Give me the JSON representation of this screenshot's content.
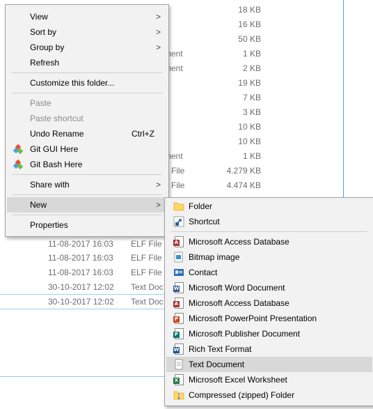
{
  "explorer": {
    "rows": [
      {
        "type": "",
        "size": "18 KB"
      },
      {
        "type": "",
        "size": "16 KB"
      },
      {
        "type": "",
        "size": "50 KB"
      },
      {
        "type": "ment",
        "size": "1 KB"
      },
      {
        "type": "ment",
        "size": "2 KB"
      },
      {
        "type": "e",
        "size": "19 KB"
      },
      {
        "type": "",
        "size": "7 KB"
      },
      {
        "type": "",
        "size": "3 KB"
      },
      {
        "type": "",
        "size": "10 KB"
      },
      {
        "type": "",
        "size": "10 KB"
      },
      {
        "type": "ment",
        "size": "1 KB"
      },
      {
        "type": "e File",
        "size": "4.279 KB"
      },
      {
        "type": "e File",
        "size": "4.474 KB"
      }
    ],
    "lower_rows": [
      {
        "date": "11-08-2017 16:03",
        "type": "ELF File"
      },
      {
        "date": "11-08-2017 16:03",
        "type": "ELF File"
      },
      {
        "date": "11-08-2017 16:03",
        "type": "ELF File"
      },
      {
        "date": "30-10-2017 12:02",
        "type": "Text Doc"
      },
      {
        "date": "30-10-2017 12:02",
        "type": "Text Doc"
      }
    ]
  },
  "context_menu": {
    "view": "View",
    "sort_by": "Sort by",
    "group_by": "Group by",
    "refresh": "Refresh",
    "customize": "Customize this folder...",
    "paste": "Paste",
    "paste_shortcut": "Paste shortcut",
    "undo_rename": "Undo Rename",
    "undo_shortcut": "Ctrl+Z",
    "git_gui": "Git GUI Here",
    "git_bash": "Git Bash Here",
    "share_with": "Share with",
    "new": "New",
    "properties": "Properties"
  },
  "new_menu": {
    "folder": "Folder",
    "shortcut": "Shortcut",
    "items": [
      {
        "label": "Microsoft Access Database",
        "icon": "access-icon"
      },
      {
        "label": "Bitmap image",
        "icon": "bitmap-icon"
      },
      {
        "label": "Contact",
        "icon": "contact-icon"
      },
      {
        "label": "Microsoft Word Document",
        "icon": "word-icon"
      },
      {
        "label": "Microsoft Access Database",
        "icon": "access-icon"
      },
      {
        "label": "Microsoft PowerPoint Presentation",
        "icon": "powerpoint-icon"
      },
      {
        "label": "Microsoft Publisher Document",
        "icon": "publisher-icon"
      },
      {
        "label": "Rich Text Format",
        "icon": "wordpad-icon"
      },
      {
        "label": "Text Document",
        "icon": "text-document-icon"
      },
      {
        "label": "Microsoft Excel Worksheet",
        "icon": "excel-icon"
      },
      {
        "label": "Compressed (zipped) Folder",
        "icon": "zip-folder-icon"
      }
    ]
  },
  "colors": {
    "menu_bg": "#f2f2f2",
    "highlight": "#d8d8d8",
    "window_border": "#46a6d6"
  }
}
